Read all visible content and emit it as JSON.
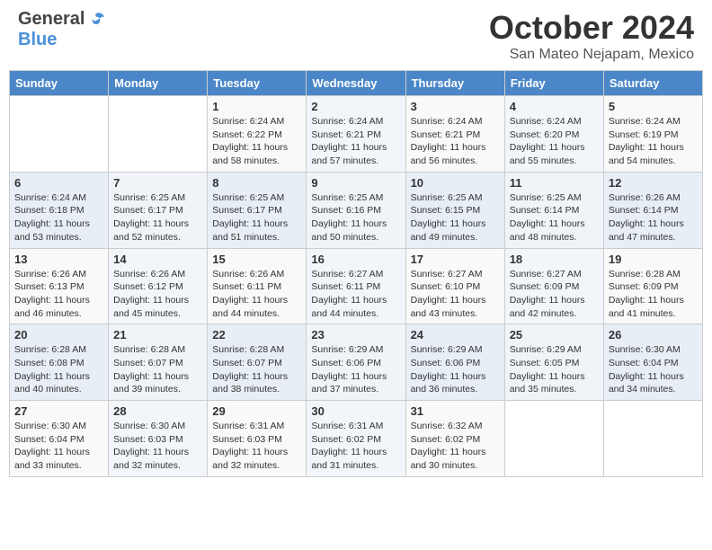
{
  "header": {
    "logo_general": "General",
    "logo_blue": "Blue",
    "month_title": "October 2024",
    "location": "San Mateo Nejapam, Mexico"
  },
  "days_of_week": [
    "Sunday",
    "Monday",
    "Tuesday",
    "Wednesday",
    "Thursday",
    "Friday",
    "Saturday"
  ],
  "weeks": [
    [
      {
        "day": "",
        "sunrise": "",
        "sunset": "",
        "daylight": ""
      },
      {
        "day": "",
        "sunrise": "",
        "sunset": "",
        "daylight": ""
      },
      {
        "day": "1",
        "sunrise": "Sunrise: 6:24 AM",
        "sunset": "Sunset: 6:22 PM",
        "daylight": "Daylight: 11 hours and 58 minutes."
      },
      {
        "day": "2",
        "sunrise": "Sunrise: 6:24 AM",
        "sunset": "Sunset: 6:21 PM",
        "daylight": "Daylight: 11 hours and 57 minutes."
      },
      {
        "day": "3",
        "sunrise": "Sunrise: 6:24 AM",
        "sunset": "Sunset: 6:21 PM",
        "daylight": "Daylight: 11 hours and 56 minutes."
      },
      {
        "day": "4",
        "sunrise": "Sunrise: 6:24 AM",
        "sunset": "Sunset: 6:20 PM",
        "daylight": "Daylight: 11 hours and 55 minutes."
      },
      {
        "day": "5",
        "sunrise": "Sunrise: 6:24 AM",
        "sunset": "Sunset: 6:19 PM",
        "daylight": "Daylight: 11 hours and 54 minutes."
      }
    ],
    [
      {
        "day": "6",
        "sunrise": "Sunrise: 6:24 AM",
        "sunset": "Sunset: 6:18 PM",
        "daylight": "Daylight: 11 hours and 53 minutes."
      },
      {
        "day": "7",
        "sunrise": "Sunrise: 6:25 AM",
        "sunset": "Sunset: 6:17 PM",
        "daylight": "Daylight: 11 hours and 52 minutes."
      },
      {
        "day": "8",
        "sunrise": "Sunrise: 6:25 AM",
        "sunset": "Sunset: 6:17 PM",
        "daylight": "Daylight: 11 hours and 51 minutes."
      },
      {
        "day": "9",
        "sunrise": "Sunrise: 6:25 AM",
        "sunset": "Sunset: 6:16 PM",
        "daylight": "Daylight: 11 hours and 50 minutes."
      },
      {
        "day": "10",
        "sunrise": "Sunrise: 6:25 AM",
        "sunset": "Sunset: 6:15 PM",
        "daylight": "Daylight: 11 hours and 49 minutes."
      },
      {
        "day": "11",
        "sunrise": "Sunrise: 6:25 AM",
        "sunset": "Sunset: 6:14 PM",
        "daylight": "Daylight: 11 hours and 48 minutes."
      },
      {
        "day": "12",
        "sunrise": "Sunrise: 6:26 AM",
        "sunset": "Sunset: 6:14 PM",
        "daylight": "Daylight: 11 hours and 47 minutes."
      }
    ],
    [
      {
        "day": "13",
        "sunrise": "Sunrise: 6:26 AM",
        "sunset": "Sunset: 6:13 PM",
        "daylight": "Daylight: 11 hours and 46 minutes."
      },
      {
        "day": "14",
        "sunrise": "Sunrise: 6:26 AM",
        "sunset": "Sunset: 6:12 PM",
        "daylight": "Daylight: 11 hours and 45 minutes."
      },
      {
        "day": "15",
        "sunrise": "Sunrise: 6:26 AM",
        "sunset": "Sunset: 6:11 PM",
        "daylight": "Daylight: 11 hours and 44 minutes."
      },
      {
        "day": "16",
        "sunrise": "Sunrise: 6:27 AM",
        "sunset": "Sunset: 6:11 PM",
        "daylight": "Daylight: 11 hours and 44 minutes."
      },
      {
        "day": "17",
        "sunrise": "Sunrise: 6:27 AM",
        "sunset": "Sunset: 6:10 PM",
        "daylight": "Daylight: 11 hours and 43 minutes."
      },
      {
        "day": "18",
        "sunrise": "Sunrise: 6:27 AM",
        "sunset": "Sunset: 6:09 PM",
        "daylight": "Daylight: 11 hours and 42 minutes."
      },
      {
        "day": "19",
        "sunrise": "Sunrise: 6:28 AM",
        "sunset": "Sunset: 6:09 PM",
        "daylight": "Daylight: 11 hours and 41 minutes."
      }
    ],
    [
      {
        "day": "20",
        "sunrise": "Sunrise: 6:28 AM",
        "sunset": "Sunset: 6:08 PM",
        "daylight": "Daylight: 11 hours and 40 minutes."
      },
      {
        "day": "21",
        "sunrise": "Sunrise: 6:28 AM",
        "sunset": "Sunset: 6:07 PM",
        "daylight": "Daylight: 11 hours and 39 minutes."
      },
      {
        "day": "22",
        "sunrise": "Sunrise: 6:28 AM",
        "sunset": "Sunset: 6:07 PM",
        "daylight": "Daylight: 11 hours and 38 minutes."
      },
      {
        "day": "23",
        "sunrise": "Sunrise: 6:29 AM",
        "sunset": "Sunset: 6:06 PM",
        "daylight": "Daylight: 11 hours and 37 minutes."
      },
      {
        "day": "24",
        "sunrise": "Sunrise: 6:29 AM",
        "sunset": "Sunset: 6:06 PM",
        "daylight": "Daylight: 11 hours and 36 minutes."
      },
      {
        "day": "25",
        "sunrise": "Sunrise: 6:29 AM",
        "sunset": "Sunset: 6:05 PM",
        "daylight": "Daylight: 11 hours and 35 minutes."
      },
      {
        "day": "26",
        "sunrise": "Sunrise: 6:30 AM",
        "sunset": "Sunset: 6:04 PM",
        "daylight": "Daylight: 11 hours and 34 minutes."
      }
    ],
    [
      {
        "day": "27",
        "sunrise": "Sunrise: 6:30 AM",
        "sunset": "Sunset: 6:04 PM",
        "daylight": "Daylight: 11 hours and 33 minutes."
      },
      {
        "day": "28",
        "sunrise": "Sunrise: 6:30 AM",
        "sunset": "Sunset: 6:03 PM",
        "daylight": "Daylight: 11 hours and 32 minutes."
      },
      {
        "day": "29",
        "sunrise": "Sunrise: 6:31 AM",
        "sunset": "Sunset: 6:03 PM",
        "daylight": "Daylight: 11 hours and 32 minutes."
      },
      {
        "day": "30",
        "sunrise": "Sunrise: 6:31 AM",
        "sunset": "Sunset: 6:02 PM",
        "daylight": "Daylight: 11 hours and 31 minutes."
      },
      {
        "day": "31",
        "sunrise": "Sunrise: 6:32 AM",
        "sunset": "Sunset: 6:02 PM",
        "daylight": "Daylight: 11 hours and 30 minutes."
      },
      {
        "day": "",
        "sunrise": "",
        "sunset": "",
        "daylight": ""
      },
      {
        "day": "",
        "sunrise": "",
        "sunset": "",
        "daylight": ""
      }
    ]
  ]
}
